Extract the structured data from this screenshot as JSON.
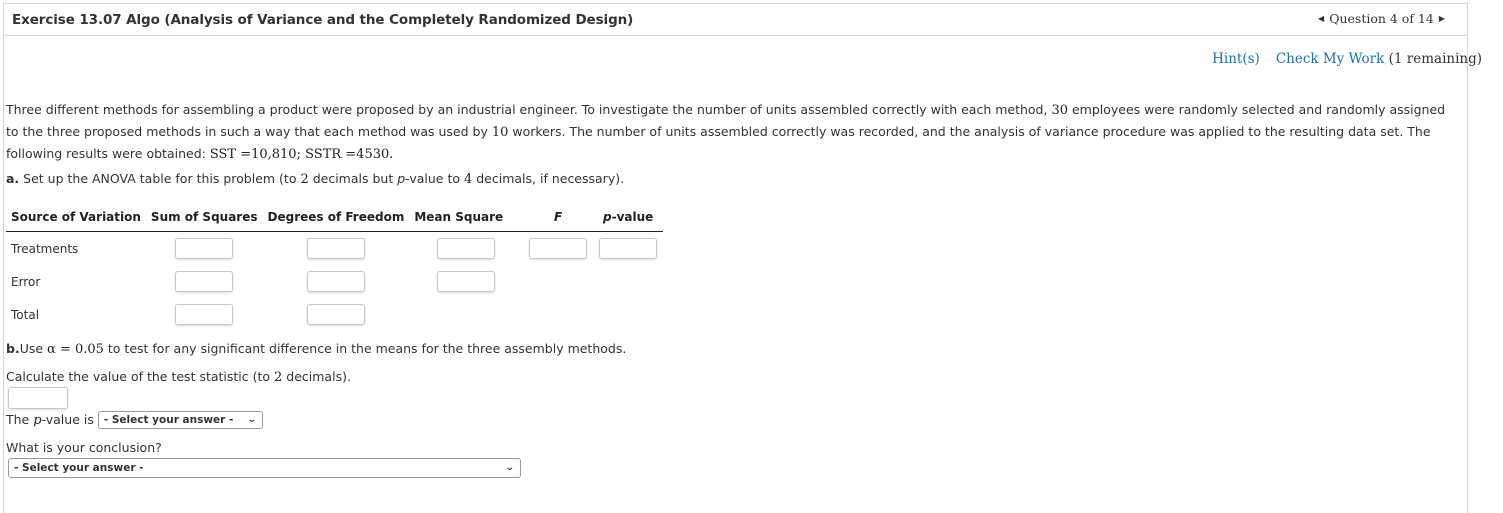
{
  "header": {
    "title": "Exercise 13.07 Algo (Analysis of Variance and the Completely Randomized Design)",
    "question_nav": "Question 4 of 14",
    "prev_icon": "caret-left-icon",
    "next_icon": "caret-right-icon"
  },
  "toolbar": {
    "hint_label": "Hint(s)",
    "check_label": "Check My Work",
    "check_remaining": "(1 remaining)"
  },
  "problem": {
    "p1": "Three different methods for assembling a product were proposed by an industrial engineer. To investigate the number of units assembled correctly with each method, ",
    "n_employees": "30",
    "p2": " employees were randomly selected and randomly assigned to the three proposed methods in such a way that each method was used by ",
    "n_workers": "10",
    "p3": " workers. The number of units assembled correctly was recorded, and the analysis of variance procedure was applied to the resulting data set. The following results were obtained: ",
    "sst": "SST =10,810",
    "sep": "; ",
    "sstr": "SSTR =4530",
    "end": "."
  },
  "part_a": {
    "label": "a.",
    "text1": " Set up the ANOVA table for this problem (to ",
    "dec": "2",
    "text2": " decimals but ",
    "pval": "p",
    "text3": "-value to ",
    "dec2": "4",
    "text4": " decimals, if necessary)."
  },
  "anova_table": {
    "columns": [
      "Source of Variation",
      "Sum of Squares",
      "Degrees of Freedom",
      "Mean Square",
      "F",
      "p-value"
    ],
    "rows": [
      {
        "source": "Treatments",
        "sum_of_squares": "",
        "df": "",
        "mean_square": "",
        "f": "",
        "p_value": ""
      },
      {
        "source": "Error",
        "sum_of_squares": "",
        "df": "",
        "mean_square": ""
      },
      {
        "source": "Total",
        "sum_of_squares": "",
        "df": ""
      }
    ]
  },
  "part_b": {
    "label": "b.",
    "text1": "Use ",
    "alpha": "α = 0.05",
    "text2": " to test for any significant difference in the means for the three assembly methods.",
    "calc_text1": "Calculate the value of the test statistic (to ",
    "calc_dec": "2",
    "calc_text2": " decimals).",
    "test_statistic_value": "",
    "pvalue_prefix": "The ",
    "pvalue_p": "p",
    "pvalue_suffix": "-value is",
    "pvalue_select": "- Select your answer -",
    "conclusion_label": "What is your conclusion?",
    "conclusion_select": "- Select your answer -"
  }
}
